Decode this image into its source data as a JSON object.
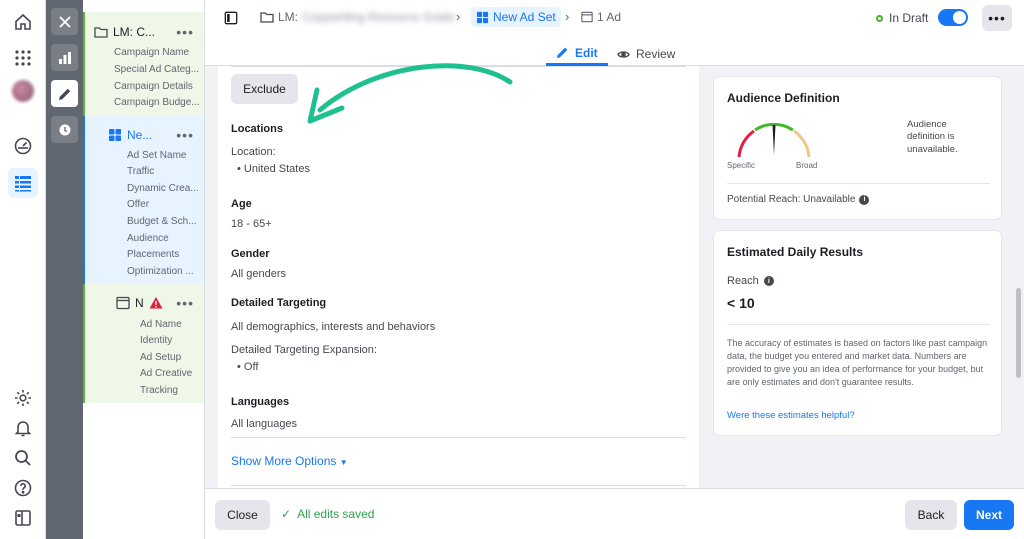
{
  "rail": {
    "icons": [
      "home-icon",
      "apps-grid-icon",
      "avatar",
      "dashboard-icon",
      "table-icon",
      "settings-icon",
      "bell-icon",
      "search-icon",
      "help-icon",
      "panel-icon"
    ]
  },
  "tree": {
    "campaign": {
      "title": "LM: C...",
      "items": [
        "Campaign Name",
        "Special Ad Categ...",
        "Campaign Details",
        "Campaign Budge..."
      ]
    },
    "adset": {
      "title": "Ne...",
      "items": [
        "Ad Set Name",
        "Traffic",
        "Dynamic Crea...",
        "Offer",
        "Budget & Sch...",
        "Audience",
        "Placements",
        "Optimization ..."
      ]
    },
    "ad": {
      "title": "N",
      "items": [
        "Ad Name",
        "Identity",
        "Ad Setup",
        "Ad Creative",
        "Tracking"
      ]
    },
    "more": "•••"
  },
  "header": {
    "campaign_prefix": "LM:",
    "campaign_name": "Copywriting Resource Guide",
    "adset_crumb": "New Ad Set",
    "ad_crumb": "1 Ad",
    "status": "In Draft",
    "more": "•••",
    "tabs": {
      "edit": "Edit",
      "review": "Review"
    }
  },
  "form": {
    "exclude_button": "Exclude",
    "locations_label": "Locations",
    "location_sublabel": "Location:",
    "location_value": "United States",
    "age_label": "Age",
    "age_value": "18 - 65+",
    "gender_label": "Gender",
    "gender_value": "All genders",
    "detailed_label": "Detailed Targeting",
    "detailed_value": "All demographics, interests and behaviors",
    "expansion_label": "Detailed Targeting Expansion:",
    "expansion_value": "Off",
    "languages_label": "Languages",
    "languages_value": "All languages",
    "show_more": "Show More Options"
  },
  "audience_card": {
    "title": "Audience Definition",
    "specific": "Specific",
    "broad": "Broad",
    "note": "Audience definition is unavailable.",
    "potential_reach": "Potential Reach: Unavailable"
  },
  "results_card": {
    "title": "Estimated Daily Results",
    "reach_label": "Reach",
    "reach_value": "< 10",
    "note": "The accuracy of estimates is based on factors like past campaign data, the budget you entered and market data. Numbers are provided to give you an idea of performance for your budget, but are only estimates and don't guarantee results.",
    "link": "Were these estimates helpful?"
  },
  "footer": {
    "close": "Close",
    "saved": "All edits saved",
    "back": "Back",
    "next": "Next"
  },
  "colors": {
    "accent": "#1877f2",
    "success": "#31a24c",
    "campaign_bg": "#eff7e8",
    "adset_bg": "#e7f3ff",
    "annotation_arrow": "#1fc08f",
    "warning": "#e41e3f"
  }
}
